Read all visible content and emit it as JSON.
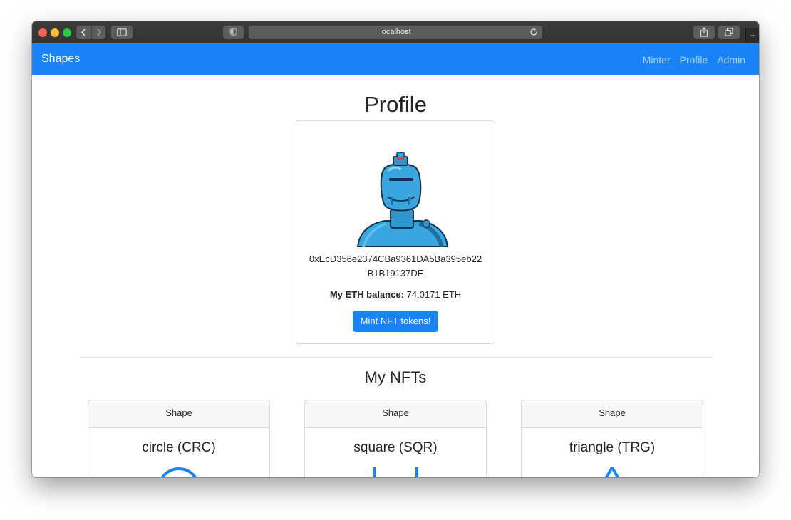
{
  "browser": {
    "address": "localhost"
  },
  "navbar": {
    "brand": "Shapes",
    "links": [
      "Minter",
      "Profile",
      "Admin"
    ]
  },
  "profile": {
    "title": "Profile",
    "address_line1": "0xEcD356e2374CBa9361DA5Ba395eb22",
    "address_line2": "B1B19137DE",
    "balance_label": "My ETH balance:",
    "balance_value": "74.0171 ETH",
    "mint_button": "Mint NFT tokens!"
  },
  "nfts": {
    "title": "My NFTs",
    "cards": [
      {
        "header": "Shape",
        "name": "circle (CRC)",
        "shape": "circle"
      },
      {
        "header": "Shape",
        "name": "square (SQR)",
        "shape": "square"
      },
      {
        "header": "Shape",
        "name": "triangle (TRG)",
        "shape": "triangle"
      }
    ]
  },
  "colors": {
    "primary": "#1a83f8",
    "robot_body": "#3aa6e0",
    "robot_accent": "#e04040"
  }
}
